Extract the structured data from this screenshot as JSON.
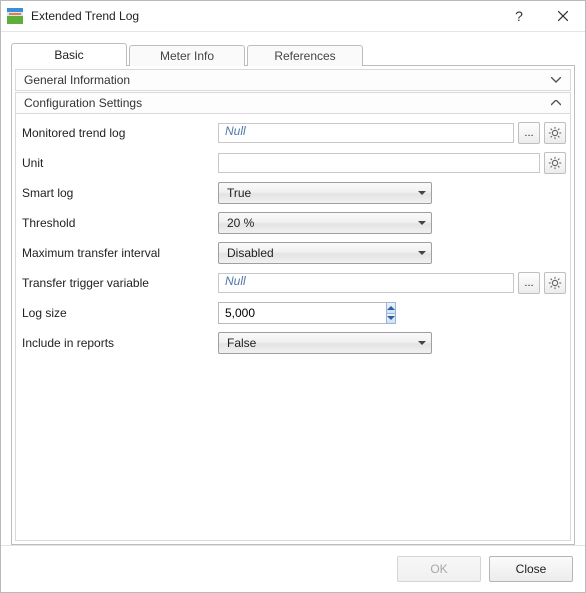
{
  "window": {
    "title": "Extended Trend Log",
    "help_symbol": "?",
    "tabs": [
      "Basic",
      "Meter Info",
      "References"
    ],
    "active_tab_index": 0
  },
  "sections": {
    "general": {
      "title": "General Information",
      "expanded": false
    },
    "config": {
      "title": "Configuration Settings",
      "expanded": true
    }
  },
  "labels": {
    "monitored": "Monitored trend log",
    "unit": "Unit",
    "smart_log": "Smart log",
    "threshold": "Threshold",
    "max_interval": "Maximum transfer interval",
    "trigger": "Transfer trigger variable",
    "log_size": "Log size",
    "include_reports": "Include in reports",
    "browse": "...",
    "ok": "OK",
    "close": "Close"
  },
  "values": {
    "monitored": "Null",
    "unit": "",
    "smart_log": "True",
    "threshold": "20 %",
    "max_interval": "Disabled",
    "trigger": "Null",
    "log_size": "5,000",
    "include_reports": "False"
  }
}
